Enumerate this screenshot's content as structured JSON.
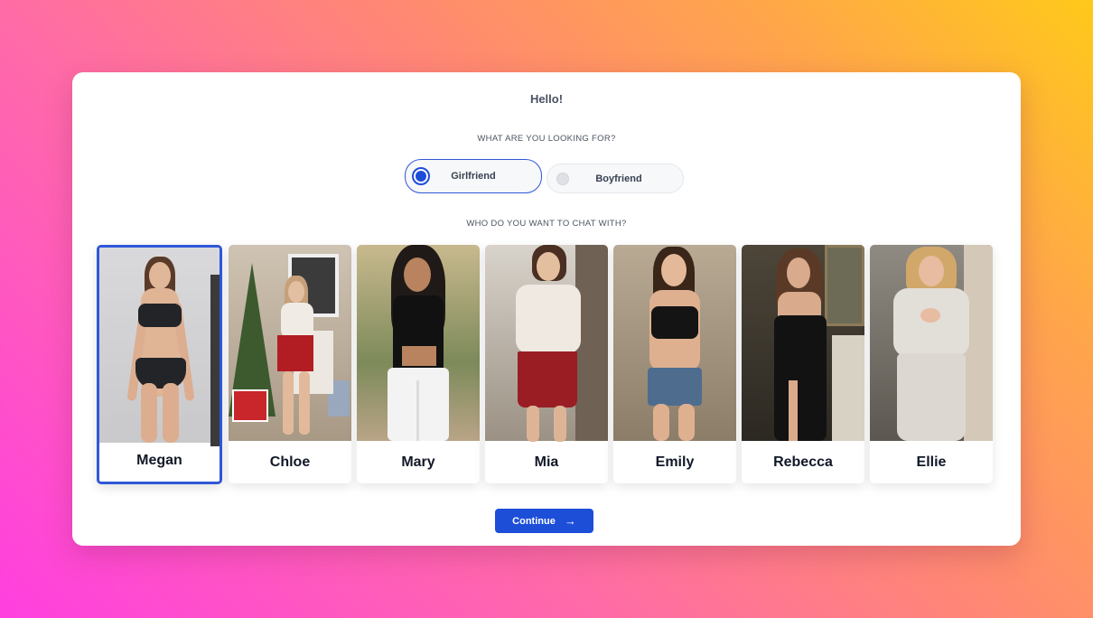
{
  "greeting": "Hello!",
  "question_looking_for": "WHAT ARE YOU LOOKING FOR?",
  "options": {
    "girlfriend": "Girlfriend",
    "boyfriend": "Boyfriend",
    "selected": "Girlfriend"
  },
  "question_chat_with": "WHO DO YOU WANT TO CHAT WITH?",
  "characters": [
    {
      "name": "Megan",
      "selected": true
    },
    {
      "name": "Chloe",
      "selected": false
    },
    {
      "name": "Mary",
      "selected": false
    },
    {
      "name": "Mia",
      "selected": false
    },
    {
      "name": "Emily",
      "selected": false
    },
    {
      "name": "Rebecca",
      "selected": false
    },
    {
      "name": "Ellie",
      "selected": false
    }
  ],
  "continue_label": "Continue",
  "continue_icon": "arrow-right-icon",
  "colors": {
    "accent": "#1d4ed8",
    "background_gradient": [
      "#ff3fe0",
      "#ffc91a"
    ]
  }
}
